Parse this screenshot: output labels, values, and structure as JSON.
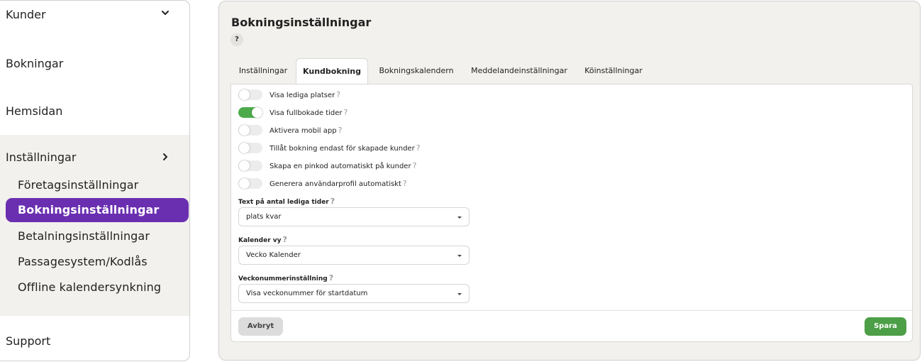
{
  "sidebar": {
    "kunder": "Kunder",
    "bokningar": "Bokningar",
    "hemsidan": "Hemsidan",
    "installningar": "Inställningar",
    "sub_items": [
      "Företagsinställningar",
      "Bokningsinställningar",
      "Betalningsinställningar",
      "Passagesystem/Kodlås",
      "Offline kalendersynkning"
    ],
    "active_sub_index": 1,
    "support": "Support",
    "active_color": "#6a2fb0"
  },
  "main": {
    "title": "Bokningsinställningar",
    "help": "?",
    "tabs": [
      {
        "label": "Inställningar",
        "active": false
      },
      {
        "label": "Kundbokning",
        "active": true
      },
      {
        "label": "Bokningskalendern",
        "active": false
      },
      {
        "label": "Meddelandeinställningar",
        "active": false
      },
      {
        "label": "Köinställningar",
        "active": false
      }
    ],
    "toggles": [
      {
        "label": "Visa lediga platser",
        "on": false
      },
      {
        "label": "Visa fullbokade tider",
        "on": true
      },
      {
        "label": "Aktivera mobil app",
        "on": false
      },
      {
        "label": "Tillåt bokning endast för skapade kunder",
        "on": false
      },
      {
        "label": "Skapa en pinkod automatiskt på kunder",
        "on": false
      },
      {
        "label": "Generera användarprofil automatiskt",
        "on": false
      }
    ],
    "help_mark": "?",
    "fields": [
      {
        "label": "Text på antal lediga tider",
        "value": "plats kvar"
      },
      {
        "label": "Kalender vy",
        "value": "Vecko Kalender"
      },
      {
        "label": "Veckonummerinställning",
        "value": "Visa veckonummer för startdatum"
      }
    ],
    "cancel_label": "Avbryt",
    "save_label": "Spara",
    "toggle_on_color": "#4caa4a",
    "save_color": "#4d9f47"
  }
}
